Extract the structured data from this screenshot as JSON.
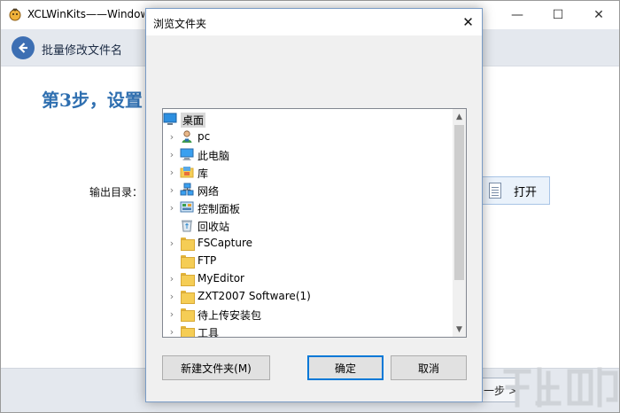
{
  "main_window": {
    "title": "XCLWinKits——Windows",
    "minimize": "—",
    "maximize": "☐",
    "close": "✕",
    "header_title": "批量修改文件名",
    "step_title": "第3步，设置",
    "output_label": "输出目录：",
    "open_button": "打开",
    "next_button": "一步 >"
  },
  "dialog": {
    "title": "浏览文件夹",
    "close": "✕",
    "tree": [
      {
        "label": "桌面",
        "icon": "desktop-icon",
        "expander": false,
        "indent": 0,
        "selected": true
      },
      {
        "label": "pc",
        "icon": "user-icon",
        "expander": true,
        "indent": 1,
        "selected": false
      },
      {
        "label": "此电脑",
        "icon": "computer-icon",
        "expander": true,
        "indent": 1,
        "selected": false
      },
      {
        "label": "库",
        "icon": "library-icon",
        "expander": true,
        "indent": 1,
        "selected": false
      },
      {
        "label": "网络",
        "icon": "network-icon",
        "expander": true,
        "indent": 1,
        "selected": false
      },
      {
        "label": "控制面板",
        "icon": "control-panel-icon",
        "expander": true,
        "indent": 1,
        "selected": false
      },
      {
        "label": "回收站",
        "icon": "recycle-bin-icon",
        "expander": false,
        "indent": 1,
        "selected": false
      },
      {
        "label": "FSCapture",
        "icon": "folder-icon",
        "expander": true,
        "indent": 1,
        "selected": false
      },
      {
        "label": "FTP",
        "icon": "folder-icon",
        "expander": false,
        "indent": 1,
        "selected": false
      },
      {
        "label": "MyEditor",
        "icon": "folder-icon",
        "expander": true,
        "indent": 1,
        "selected": false
      },
      {
        "label": "ZXT2007 Software(1)",
        "icon": "folder-icon",
        "expander": true,
        "indent": 1,
        "selected": false
      },
      {
        "label": "待上传安装包",
        "icon": "folder-icon",
        "expander": true,
        "indent": 1,
        "selected": false
      },
      {
        "label": "工具",
        "icon": "folder-icon",
        "expander": true,
        "indent": 1,
        "selected": false
      }
    ],
    "scroll_up": "▲",
    "scroll_down": "▼",
    "new_folder_button": "新建文件夹(M)",
    "ok_button": "确定",
    "cancel_button": "取消"
  },
  "colors": {
    "accent_blue": "#2f6fb0",
    "header_band": "#e4e8ee",
    "selection_gray": "#d9d9d9",
    "folder_yellow": "#f5cd55"
  }
}
